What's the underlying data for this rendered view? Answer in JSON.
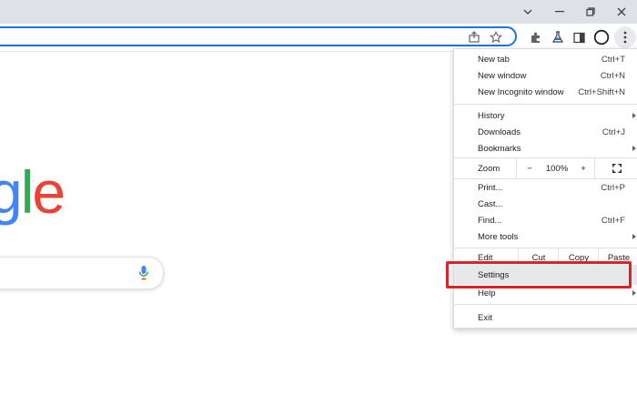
{
  "colors": {
    "titlebar": "#dee1e6",
    "omnibox_border": "#1a73e8",
    "highlight_red": "#d9222a",
    "google_blue": "#4285f4",
    "google_green": "#34a853",
    "google_red": "#ea4335"
  },
  "window_controls": [
    "chevron-down-icon",
    "minimize-icon",
    "restore-icon",
    "close-icon"
  ],
  "toolbar_icons": [
    "share-icon",
    "star-icon",
    "extensions-icon",
    "labs-icon",
    "side-panel-icon",
    "profile-icon",
    "more-menu-icon"
  ],
  "logo": {
    "letters": [
      "g",
      "l",
      "e"
    ]
  },
  "menu": {
    "group1": [
      {
        "label": "New tab",
        "shortcut": "Ctrl+T"
      },
      {
        "label": "New window",
        "shortcut": "Ctrl+N"
      },
      {
        "label": "New Incognito window",
        "shortcut": "Ctrl+Shift+N"
      }
    ],
    "group2": [
      {
        "label": "History",
        "shortcut": ""
      },
      {
        "label": "Downloads",
        "shortcut": "Ctrl+J"
      },
      {
        "label": "Bookmarks",
        "shortcut": ""
      }
    ],
    "zoom": {
      "label": "Zoom",
      "minus": "−",
      "value": "100%",
      "plus": "+"
    },
    "group3": [
      {
        "label": "Print...",
        "shortcut": "Ctrl+P"
      },
      {
        "label": "Cast...",
        "shortcut": ""
      },
      {
        "label": "Find...",
        "shortcut": "Ctrl+F"
      },
      {
        "label": "More tools",
        "shortcut": ""
      }
    ],
    "edit": {
      "label": "Edit",
      "cut": "Cut",
      "copy": "Copy",
      "paste": "Paste"
    },
    "settings": "Settings",
    "help": "Help",
    "exit": "Exit"
  }
}
